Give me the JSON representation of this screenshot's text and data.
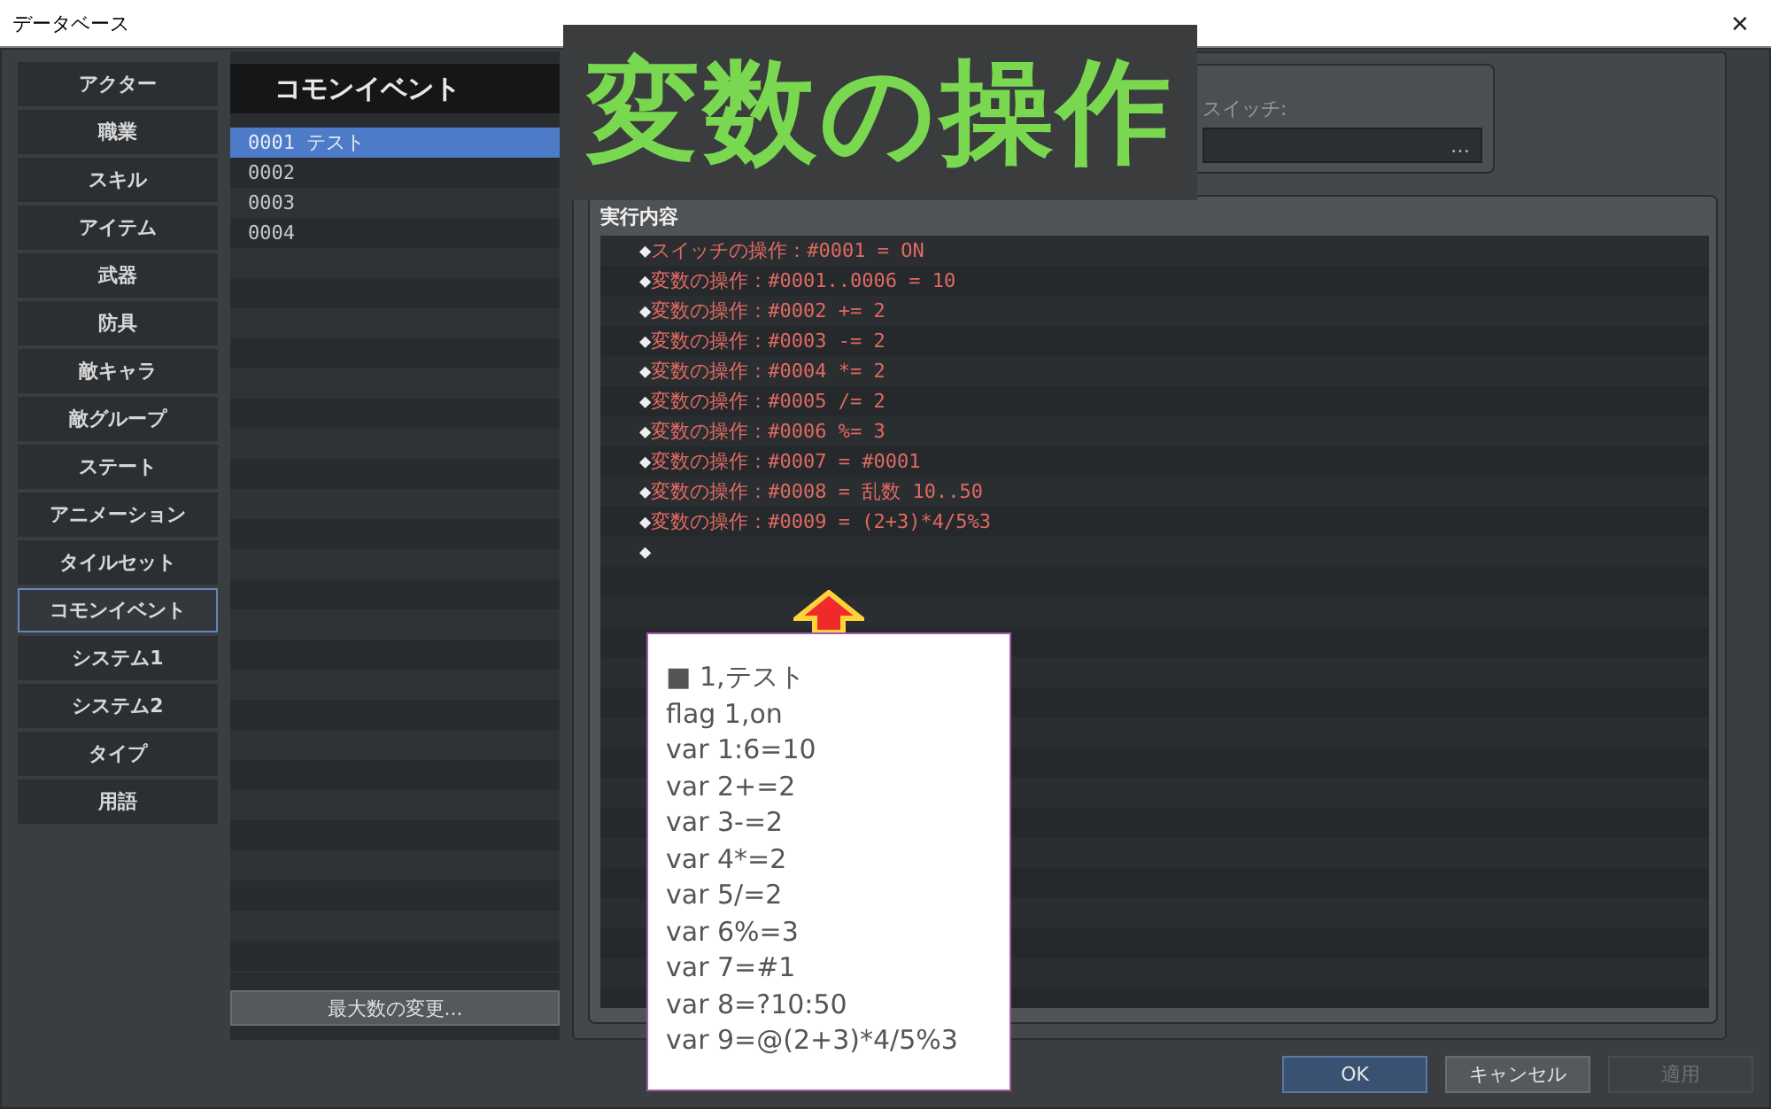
{
  "window": {
    "title": "データベース",
    "close": "✕"
  },
  "sidebar": {
    "items": [
      {
        "label": "アクター",
        "selected": false
      },
      {
        "label": "職業",
        "selected": false
      },
      {
        "label": "スキル",
        "selected": false
      },
      {
        "label": "アイテム",
        "selected": false
      },
      {
        "label": "武器",
        "selected": false
      },
      {
        "label": "防具",
        "selected": false
      },
      {
        "label": "敵キャラ",
        "selected": false
      },
      {
        "label": "敵グループ",
        "selected": false
      },
      {
        "label": "ステート",
        "selected": false
      },
      {
        "label": "アニメーション",
        "selected": false
      },
      {
        "label": "タイルセット",
        "selected": false
      },
      {
        "label": "コモンイベント",
        "selected": true
      },
      {
        "label": "システム1",
        "selected": false
      },
      {
        "label": "システム2",
        "selected": false
      },
      {
        "label": "タイプ",
        "selected": false
      },
      {
        "label": "用語",
        "selected": false
      }
    ]
  },
  "list": {
    "header": "コモンイベント",
    "items": [
      {
        "label": "0001 テスト",
        "selected": true
      },
      {
        "label": "0002",
        "selected": false
      },
      {
        "label": "0003",
        "selected": false
      },
      {
        "label": "0004",
        "selected": false
      }
    ],
    "button": "最大数の変更..."
  },
  "general": {
    "switch_label": "スイッチ:",
    "switch_button": "…"
  },
  "contents": {
    "title": "実行内容",
    "rows": [
      {
        "bullet": "◆",
        "text": "スイッチの操作：#0001 = ON"
      },
      {
        "bullet": "◆",
        "text": "変数の操作：#0001..0006 = 10"
      },
      {
        "bullet": "◆",
        "text": "変数の操作：#0002 += 2"
      },
      {
        "bullet": "◆",
        "text": "変数の操作：#0003 -= 2"
      },
      {
        "bullet": "◆",
        "text": "変数の操作：#0004 *= 2"
      },
      {
        "bullet": "◆",
        "text": "変数の操作：#0005 /= 2"
      },
      {
        "bullet": "◆",
        "text": "変数の操作：#0006 %= 3"
      },
      {
        "bullet": "◆",
        "text": "変数の操作：#0007 = #0001"
      },
      {
        "bullet": "◆",
        "text": "変数の操作：#0008 = 乱数 10..50"
      },
      {
        "bullet": "◆",
        "text": "変数の操作：#0009 = (2+3)*4/5%3"
      },
      {
        "bullet": "◆"
      }
    ]
  },
  "buttons": [
    {
      "label": "OK",
      "kind": "primary"
    },
    {
      "label": "キャンセル",
      "kind": "normal"
    },
    {
      "label": "適用",
      "kind": "disabled"
    }
  ],
  "banner": {
    "title": "変数の操作"
  },
  "note": {
    "lines": [
      "■ 1,テスト",
      "flag 1,on",
      "var 1:6=10",
      "var 2+=2",
      "var 3-=2",
      "var 4*=2",
      "var 5/=2",
      "var 6%=3",
      "var 7=#1",
      "var 8=?10:50",
      "var 9=@(2+3)*4/5%3"
    ]
  }
}
